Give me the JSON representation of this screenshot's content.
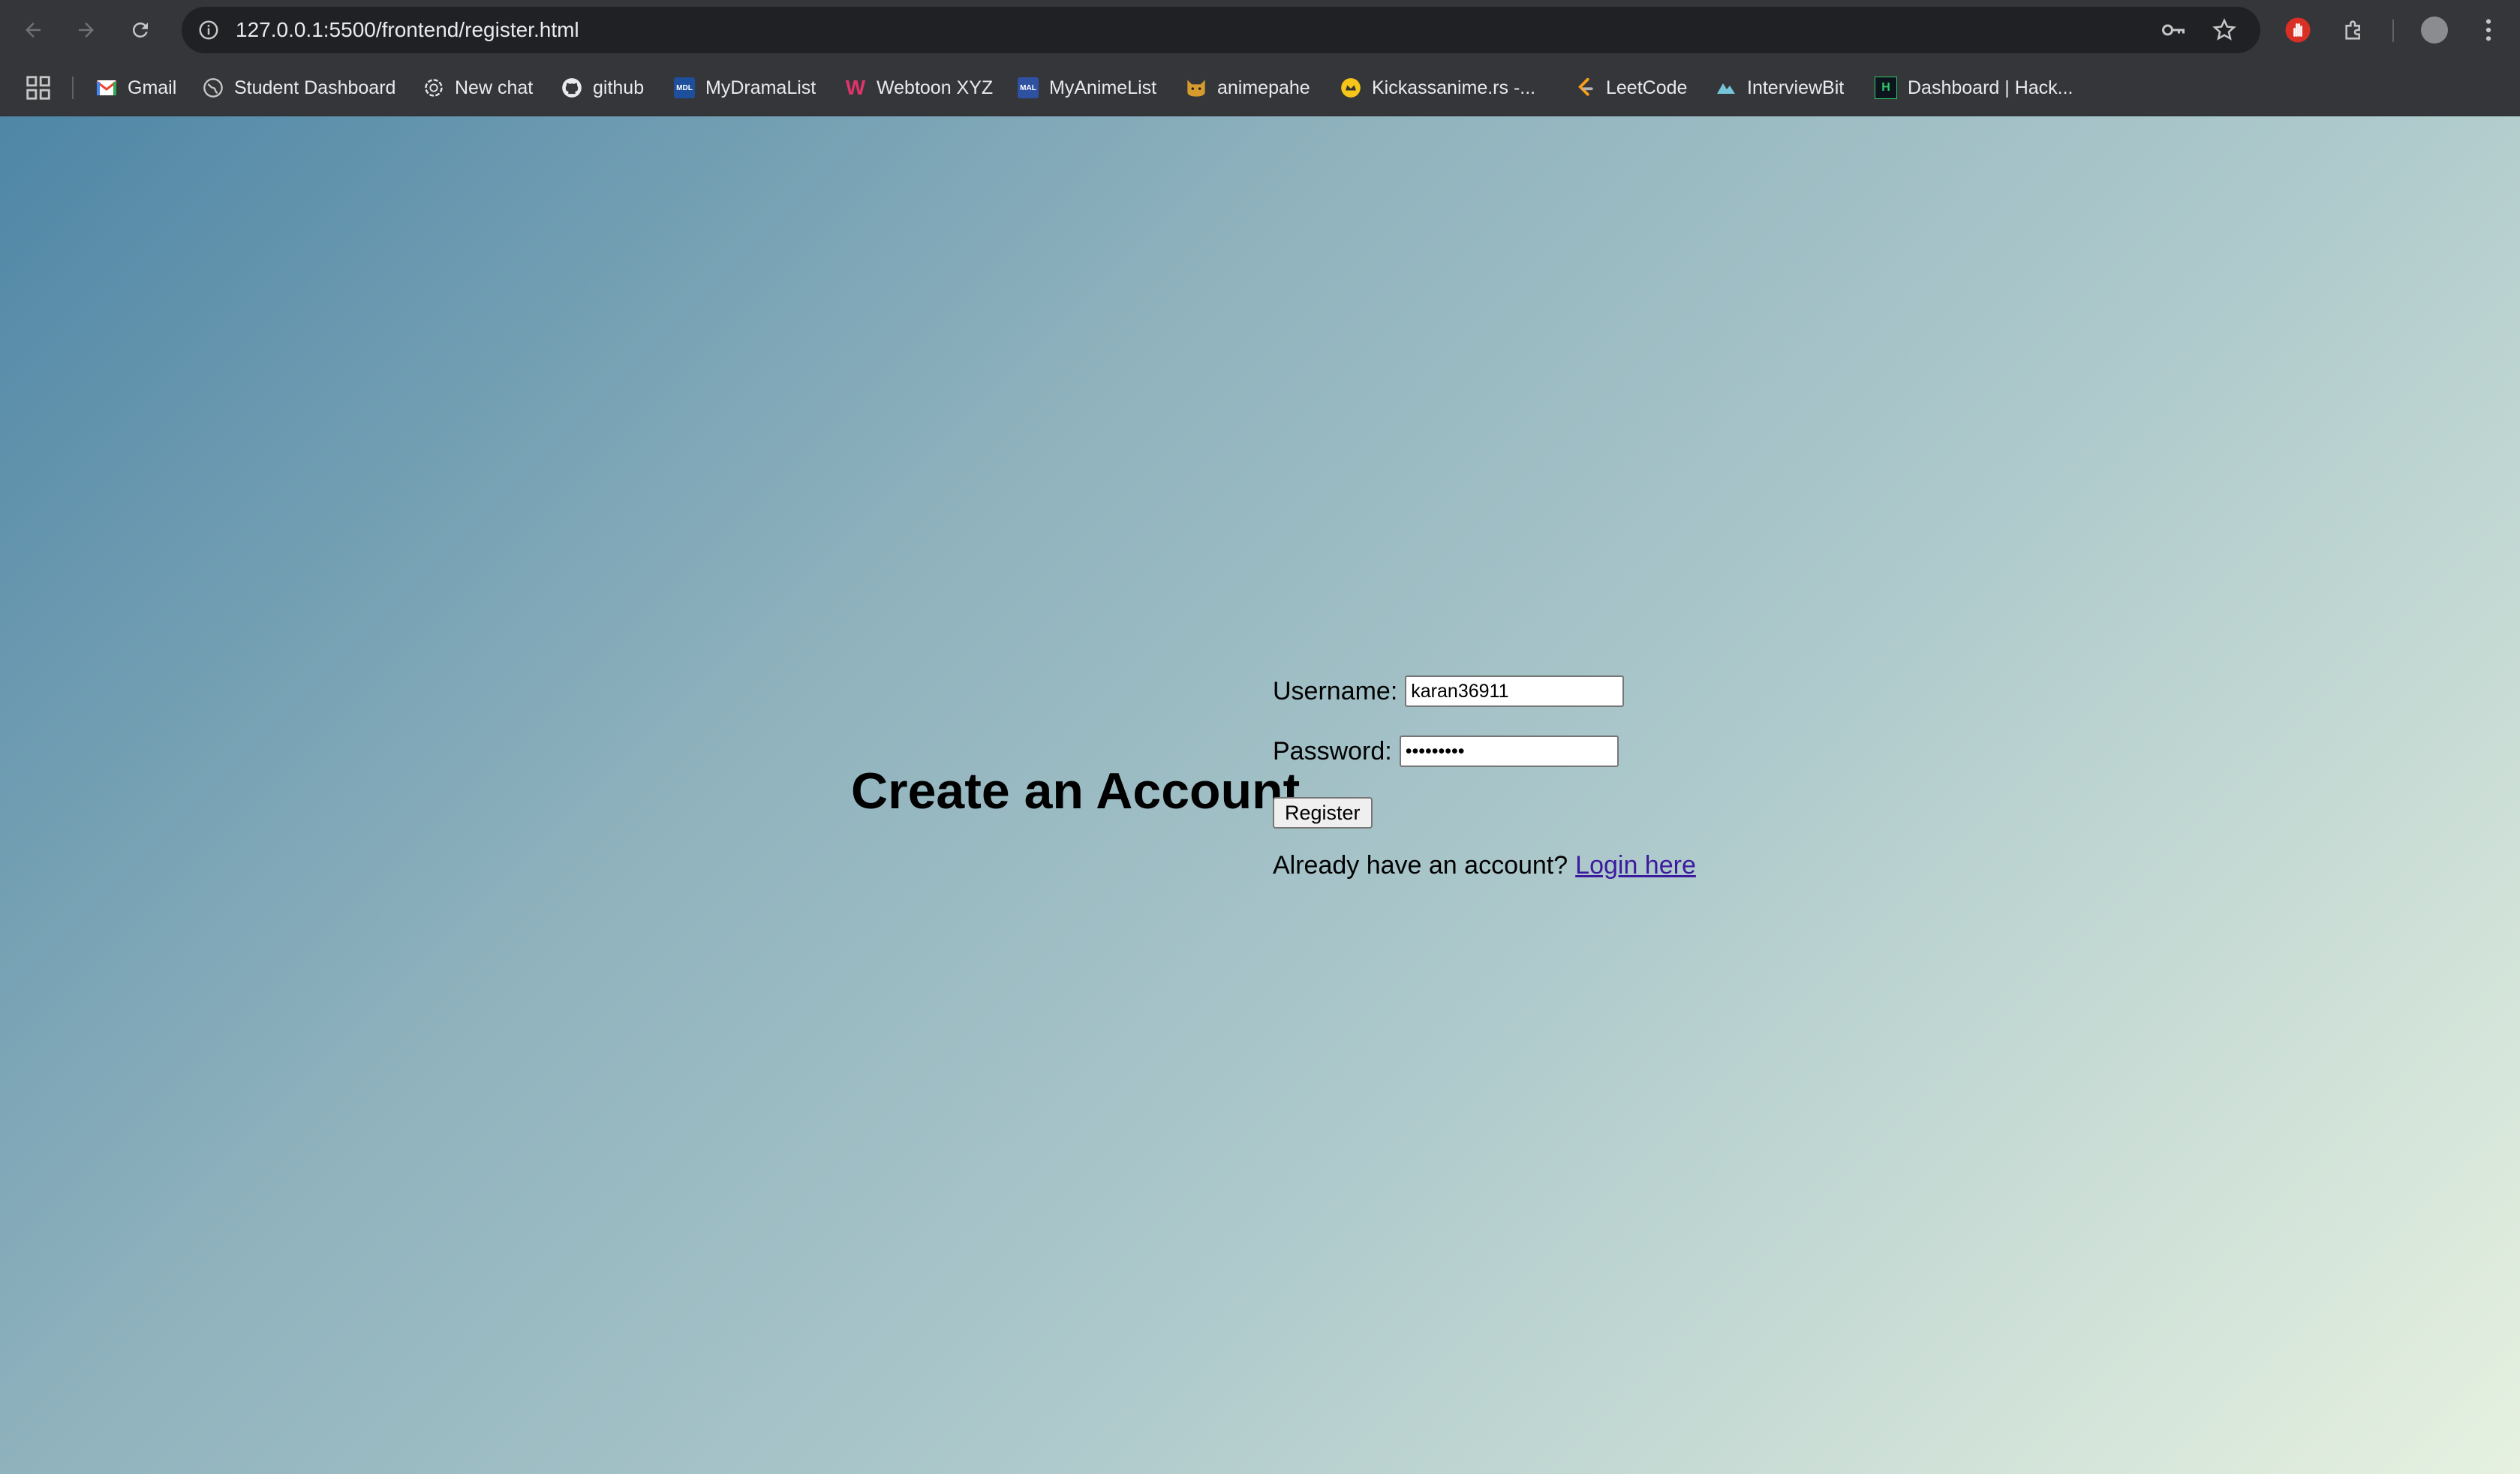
{
  "browser": {
    "url": "127.0.0.1:5500/frontend/register.html",
    "bookmarks": [
      {
        "label": "Gmail",
        "icon": "gmail-icon"
      },
      {
        "label": "Student Dashboard",
        "icon": "globe-icon"
      },
      {
        "label": "New chat",
        "icon": "chatgpt-icon"
      },
      {
        "label": "github",
        "icon": "github-icon"
      },
      {
        "label": "MyDramaList",
        "icon": "mydramalist-icon"
      },
      {
        "label": "Webtoon XYZ",
        "icon": "webtoon-icon"
      },
      {
        "label": "MyAnimeList",
        "icon": "myanimelist-icon"
      },
      {
        "label": "animepahe",
        "icon": "animepahe-icon"
      },
      {
        "label": "Kickassanime.rs -...",
        "icon": "kickassanime-icon"
      },
      {
        "label": "LeetCode",
        "icon": "leetcode-icon"
      },
      {
        "label": "InterviewBit",
        "icon": "interviewbit-icon"
      },
      {
        "label": "Dashboard | Hack...",
        "icon": "hackerrank-icon"
      }
    ],
    "favicon_text": {
      "mydramalist": "MDL",
      "myanimelist": "MAL",
      "webtoon": "W",
      "hackerrank": "H"
    }
  },
  "page": {
    "heading": "Create an Account",
    "username_label": "Username:",
    "username_value": "karan36911",
    "password_label": "Password:",
    "password_value": "karan3691",
    "register_label": "Register",
    "login_prompt": "Already have an account?",
    "login_link": "Login here"
  },
  "colors": {
    "gradient_start": "#4f86a6",
    "gradient_end": "#e6f1e0",
    "link": "#3c1a9e",
    "toolbar": "#35363a"
  }
}
